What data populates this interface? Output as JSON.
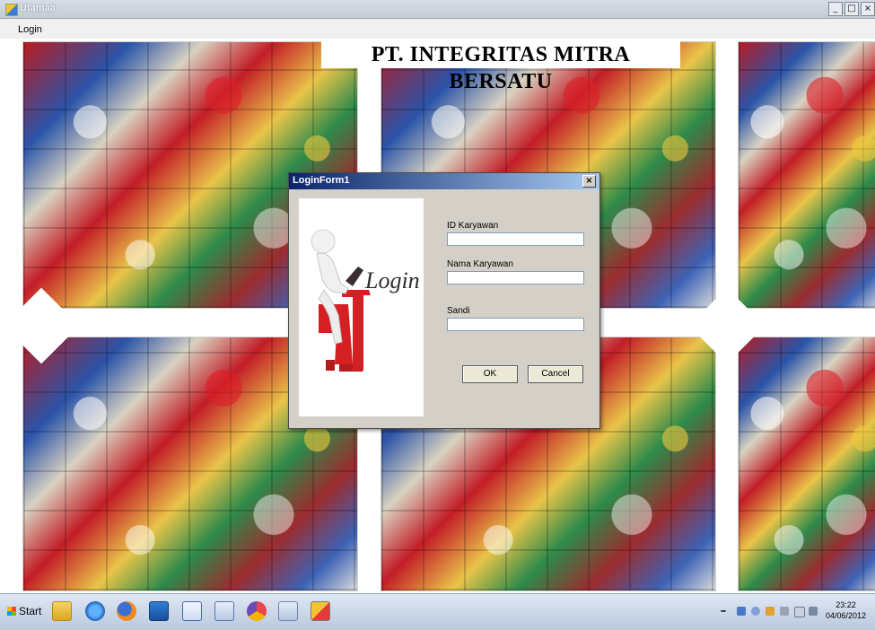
{
  "window": {
    "title": "Utamaa",
    "controls": {
      "minimize": "_",
      "maximize": "□",
      "close": "×"
    }
  },
  "menu": {
    "items": [
      "Login"
    ]
  },
  "header": {
    "company": "PT. INTEGRITAS MITRA BERSATU"
  },
  "login_dialog": {
    "title": "LoginForm1",
    "close_glyph": "×",
    "picture_caption": "Login !",
    "fields": [
      {
        "label": "ID Karyawan",
        "value": "",
        "placeholder": ""
      },
      {
        "label": "Nama Karyawan",
        "value": "",
        "placeholder": ""
      },
      {
        "label": "Sandi",
        "value": "",
        "placeholder": ""
      }
    ],
    "ok_label": "OK",
    "cancel_label": "Cancel"
  },
  "taskbar": {
    "start_label": "Start",
    "pinned": [
      "folder-icon",
      "ie-icon",
      "firefox-icon",
      "outlook-icon",
      "word-icon",
      "paint-icon",
      "visual-studio-icon",
      "network-icon",
      "app-form-icon"
    ],
    "clock_time": "23:22",
    "clock_date": "04/06/2012"
  },
  "colors": {
    "dialog_title_start": "#0a246a",
    "dialog_title_end": "#a6caf0",
    "dialog_face": "#d4d0c8"
  }
}
